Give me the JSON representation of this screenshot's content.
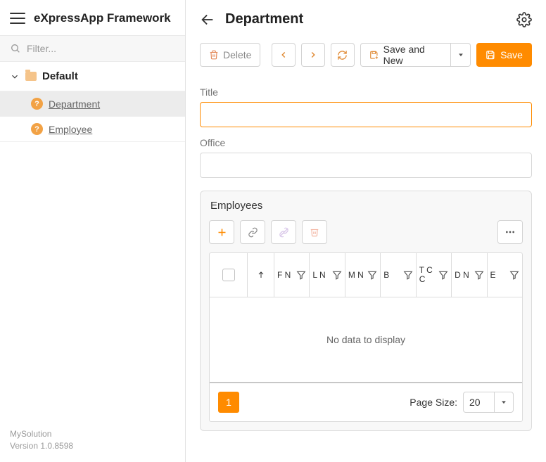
{
  "brand": "eXpressApp Framework",
  "sidebar": {
    "filter_placeholder": "Filter...",
    "group_label": "Default",
    "items": [
      {
        "label": "Department"
      },
      {
        "label": "Employee"
      }
    ]
  },
  "footer": {
    "solution": "MySolution",
    "version": "Version 1.0.8598"
  },
  "page_title": "Department",
  "toolbar": {
    "delete": "Delete",
    "save_and_new": "Save and New",
    "save": "Save"
  },
  "form": {
    "title_label": "Title",
    "title_value": "",
    "office_label": "Office",
    "office_value": ""
  },
  "employees_panel": {
    "title": "Employees",
    "columns": [
      "F N",
      "L N",
      "M N",
      "B",
      "T C C",
      "D N",
      "E"
    ],
    "no_data": "No data to display",
    "current_page": "1",
    "page_size_label": "Page Size:",
    "page_size_value": "20"
  }
}
